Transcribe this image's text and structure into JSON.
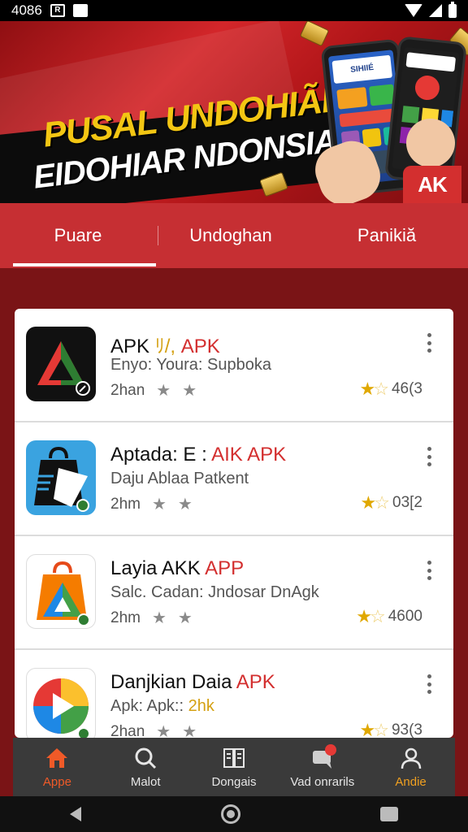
{
  "status_bar": {
    "time": "4086",
    "icons": [
      "notification-r-icon",
      "image-icon",
      "wifi-icon",
      "signal-icon",
      "battery-icon"
    ]
  },
  "banner": {
    "headline_line1": "PUSAL UNDOHIÃN",
    "headline_line2": "EIDOHIAR NDONSIA",
    "badge": "AK",
    "phone_screen_text": "SIHIIÉ"
  },
  "tabs": [
    {
      "label": "Puare",
      "active": true
    },
    {
      "label": "Undoghan",
      "active": false
    },
    {
      "label": "Panikiă",
      "active": false
    }
  ],
  "apps": [
    {
      "title_main": "APK",
      "title_gold": "ﾘ/,",
      "title_highlight": "APK",
      "subtitle": "Enyo: Youra: Supboka",
      "subtitle_gold": "",
      "meta": "2han",
      "rating": "46(3",
      "icon": "triangle-icon"
    },
    {
      "title_main": "Aptada: E :",
      "title_gold": "",
      "title_highlight": "AIK APK",
      "subtitle": "Daju Ablaa Patkent",
      "subtitle_gold": "",
      "meta": "2hm",
      "rating": "03[2",
      "icon": "shopping-bag-icon"
    },
    {
      "title_main": "Layia AKK",
      "title_gold": "",
      "title_highlight": "APP",
      "subtitle": "Salc. Cadan: Jndosar DnAgk",
      "subtitle_gold": "",
      "meta": "2hm",
      "rating": "4600",
      "icon": "colorful-bag-icon"
    },
    {
      "title_main": "Danjkian Daia",
      "title_gold": "",
      "title_highlight": "APK",
      "subtitle": "Apk: Apk::",
      "subtitle_gold": "2hk",
      "meta": "2han",
      "rating": "93(3",
      "icon": "play-store-icon"
    }
  ],
  "bottom_nav": [
    {
      "label": "Appe",
      "icon": "home-icon"
    },
    {
      "label": "Malot",
      "icon": "search-icon"
    },
    {
      "label": "Dongais",
      "icon": "book-icon"
    },
    {
      "label": "Vad onrarils",
      "icon": "chat-icon"
    },
    {
      "label": "Andie",
      "icon": "user-icon"
    }
  ],
  "colors": {
    "brand_red": "#c62f33",
    "dark_red": "#7a1416",
    "accent_orange": "#f05a28",
    "star_gold": "#e0a800"
  }
}
